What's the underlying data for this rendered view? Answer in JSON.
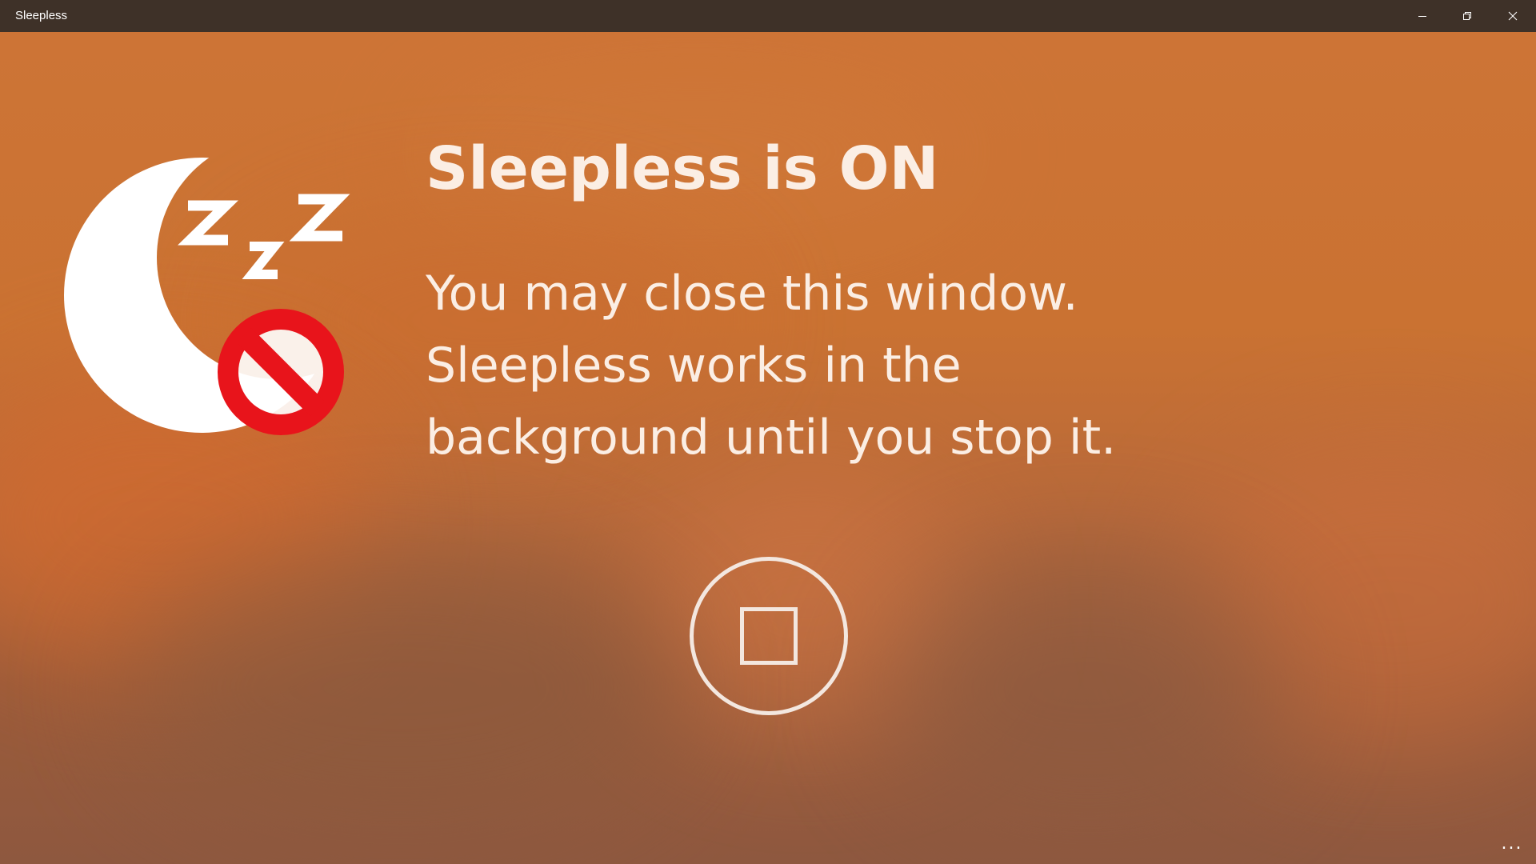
{
  "window": {
    "title": "Sleepless",
    "caption_buttons": {
      "minimize_icon": "minimize-icon",
      "restore_icon": "restore-icon",
      "close_icon": "close-icon"
    }
  },
  "main": {
    "logo_icon": "moon-zzz-no-sleep-icon",
    "status_title": "Sleepless is ON",
    "message_lines": [
      "You may close this window.",
      "Sleepless works in the",
      "background until you stop it."
    ],
    "stop_icon": "stop-icon"
  },
  "app_bar": {
    "more_label": "..."
  },
  "colors": {
    "titlebar": "#3e3128",
    "background_top": "#cd7436",
    "background_bottom": "#8e583f",
    "text": "#fbeee4",
    "prohibition_red": "#e8141b"
  }
}
